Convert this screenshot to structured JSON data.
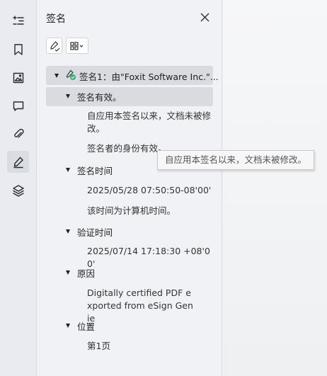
{
  "rail": {
    "icons": [
      "outline-icon",
      "bookmark-icon",
      "image-icon",
      "comment-icon",
      "attachment-icon",
      "signature-icon",
      "layers-icon"
    ],
    "active": "signature-icon"
  },
  "panel": {
    "title": "签名",
    "close_icon": "close-icon",
    "tools": [
      "sign-tool-icon",
      "grid-options-icon"
    ]
  },
  "tree": {
    "root_label": "签名1：由\"Foxit Software Inc.\"...",
    "validity": {
      "label": "签名有效。",
      "items": [
        "自应用本签名以来，文档未被修改。",
        "签名者的身份有效。"
      ]
    },
    "signing_time": {
      "label": "签名时间",
      "items": [
        "2025/05/28 07:50:50-08'00'",
        "该时间为计算机时间。"
      ]
    },
    "verify_time": {
      "label": "验证时间",
      "items": [
        "2025/07/14 17:18:30 +08'00'"
      ]
    },
    "reason": {
      "label": "原因",
      "items": [
        "Digitally certified PDF exported from eSign Genie"
      ]
    },
    "location": {
      "label": "位置",
      "items": [
        "第1页"
      ]
    }
  },
  "tooltip": {
    "text": "自应用本签名以来，文档未被修改。"
  },
  "colors": {
    "valid_check": "#2bb673",
    "selection": "#d9dbe1"
  }
}
